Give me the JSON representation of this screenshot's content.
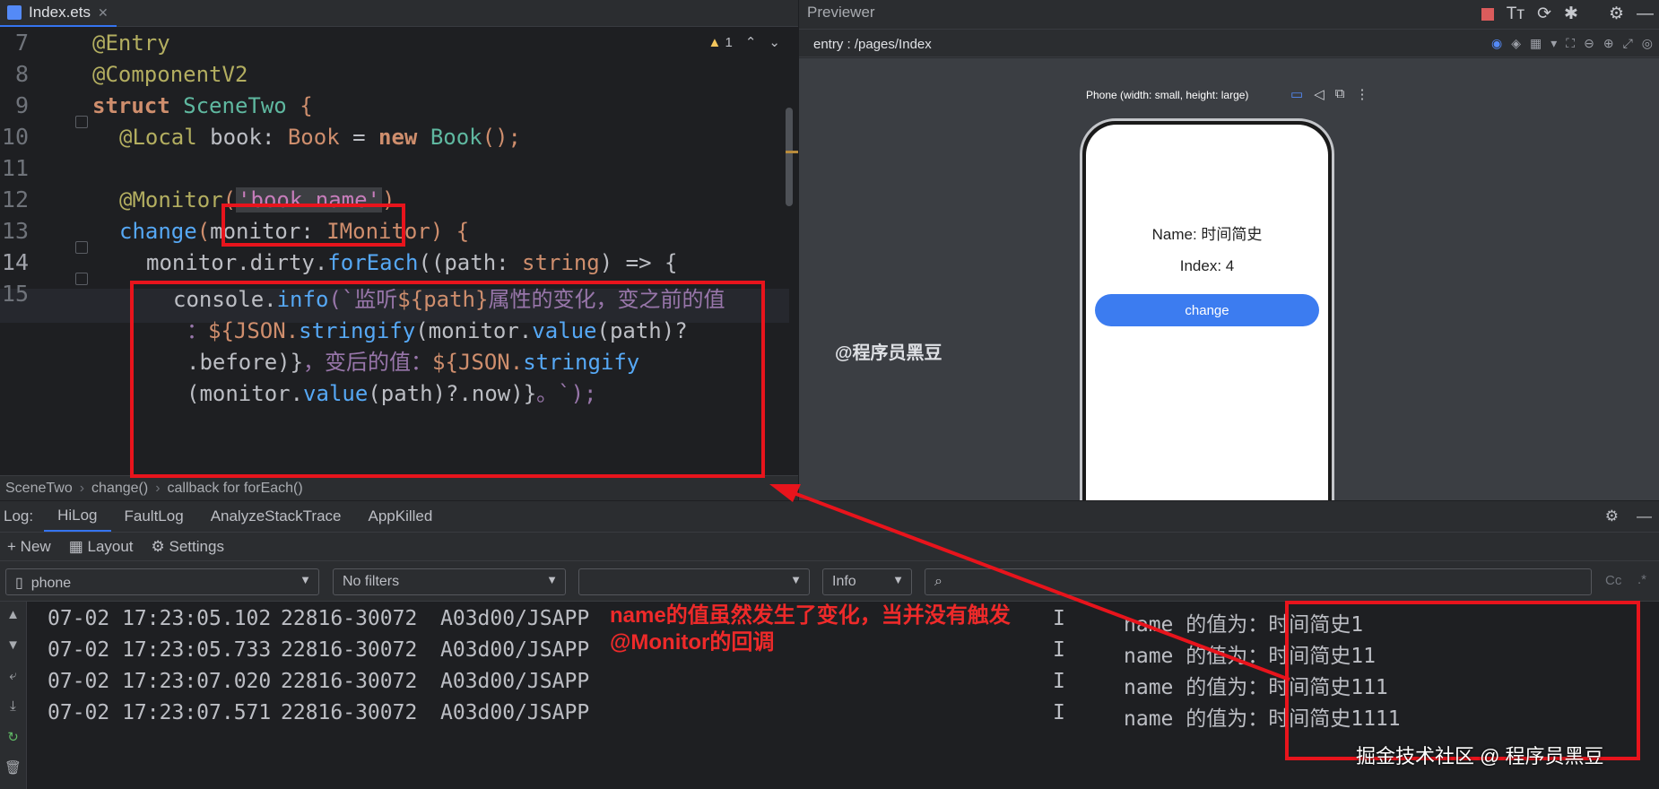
{
  "editor": {
    "tab_label": "Index.ets",
    "warning_count": "1",
    "line_numbers": [
      "7",
      "8",
      "9",
      "10",
      "11",
      "12",
      "13",
      "14",
      "15"
    ],
    "lines": {
      "l7_ann": "@Entry",
      "l8_ann": "@ComponentV2",
      "l9_kw": "struct",
      "l9_name": "SceneTwo",
      "l9_brace": "{",
      "l10_ann": "@Local",
      "l10_field": "book",
      "l10_colon": ":",
      "l10_type": "Book",
      "l10_eq": "=",
      "l10_new": "new",
      "l10_ctor": "Book",
      "l10_end": "();",
      "l12_ann": "@Monitor",
      "l12_open": "(",
      "l12_str": "'book.name'",
      "l12_close": ")",
      "l13_fn": "change",
      "l13_open": "(",
      "l13_param": "monitor",
      "l13_colon": ":",
      "l13_type": "IMonitor",
      "l13_close": ") {",
      "l14_a": "monitor.dirty.",
      "l14_fn": "forEach",
      "l14_b": "((path: ",
      "l14_type": "string",
      "l14_c": ") => {",
      "l15_a": "console.",
      "l15_fn": "info",
      "l15_b": "(`监听",
      "l15_c": "${path}",
      "l15_d": "属性的变化，变之前的值",
      "l15w1_a": "：",
      "l15w1_b": "${JSON.",
      "l15w1_fn": "stringify",
      "l15w1_c": "(monitor.",
      "l15w1_fn2": "value",
      "l15w1_d": "(path)?",
      "l15w2_a": ".before)}",
      "l15w2_b": "，变后的值：",
      "l15w2_c": "${JSON.",
      "l15w2_fn": "stringify",
      "l15w3_a": "(monitor.",
      "l15w3_fn": "value",
      "l15w3_b": "(path)?.now)}",
      "l15w3_c": "。`);"
    },
    "breadcrumb": [
      "SceneTwo",
      "change()",
      "callback for forEach()"
    ]
  },
  "previewer": {
    "title": "Previewer",
    "path": "entry : /pages/Index",
    "device_label": "Phone (width: small, height: large)",
    "phone": {
      "name_text": "Name: 时间简史",
      "index_text": "Index: 4",
      "button_label": "change"
    },
    "watermark": "@程序员黑豆"
  },
  "log": {
    "label": "Log:",
    "tabs": [
      "HiLog",
      "FaultLog",
      "AnalyzeStackTrace",
      "AppKilled"
    ],
    "toolbar": {
      "new_label": "New",
      "layout_label": "Layout",
      "settings_label": "Settings"
    },
    "filters": {
      "device": "phone",
      "filter": "No filters",
      "process": "",
      "level": "Info",
      "search_placeholder": "",
      "cc": "Cc"
    },
    "rows": [
      {
        "time": "07-02 17:23:05.102",
        "pid": "22816-30072",
        "tag": "A03d00/JSAPP",
        "level": "I",
        "msg": "name 的值为：时间简史1"
      },
      {
        "time": "07-02 17:23:05.733",
        "pid": "22816-30072",
        "tag": "A03d00/JSAPP",
        "level": "I",
        "msg": "name 的值为：时间简史11"
      },
      {
        "time": "07-02 17:23:07.020",
        "pid": "22816-30072",
        "tag": "A03d00/JSAPP",
        "level": "I",
        "msg": "name 的值为：时间简史111"
      },
      {
        "time": "07-02 17:23:07.571",
        "pid": "22816-30072",
        "tag": "A03d00/JSAPP",
        "level": "I",
        "msg": "name 的值为：时间简史1111"
      }
    ]
  },
  "annotation": {
    "line1": "name的值虽然发生了变化，当并没有触发",
    "line2": "@Monitor的回调",
    "color": "#e8141c"
  },
  "footer_watermark": "掘金技术社区 @ 程序员黑豆"
}
